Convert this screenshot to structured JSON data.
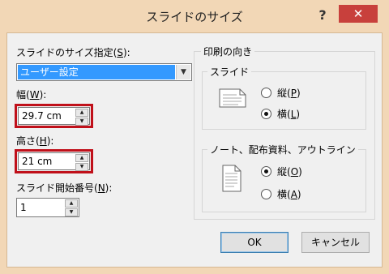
{
  "window": {
    "title": "スライドのサイズ",
    "help_label": "?",
    "close_label": "✕"
  },
  "slide_size": {
    "label_pre": "スライドのサイズ指定(",
    "label_key": "S",
    "label_post": "):",
    "value": "ユーザー設定"
  },
  "width": {
    "label_pre": "幅(",
    "label_key": "W",
    "label_post": "):",
    "value": "29.7 cm"
  },
  "height": {
    "label_pre": "高さ(",
    "label_key": "H",
    "label_post": "):",
    "value": "21 cm"
  },
  "start_number": {
    "label_pre": "スライド開始番号(",
    "label_key": "N",
    "label_post": "):",
    "value": "1"
  },
  "orientation": {
    "section_label": "印刷の向き",
    "slides": {
      "group_label": "スライド",
      "portrait_label_pre": "縦(",
      "portrait_key": "P",
      "landscape_label_pre": "横(",
      "landscape_key": "L",
      "selected": "landscape"
    },
    "notes": {
      "group_label": "ノート、配布資料、アウトライン",
      "portrait_label_pre": "縦(",
      "portrait_key": "O",
      "landscape_label_pre": "横(",
      "landscape_key": "A",
      "selected": "portrait"
    },
    "close_paren": ")"
  },
  "buttons": {
    "ok": "OK",
    "cancel": "キャンセル"
  },
  "colors": {
    "title_bar": "#f2d7b6",
    "close_button": "#c8403c",
    "highlight": "#c0101a",
    "selection": "#3399ff"
  }
}
